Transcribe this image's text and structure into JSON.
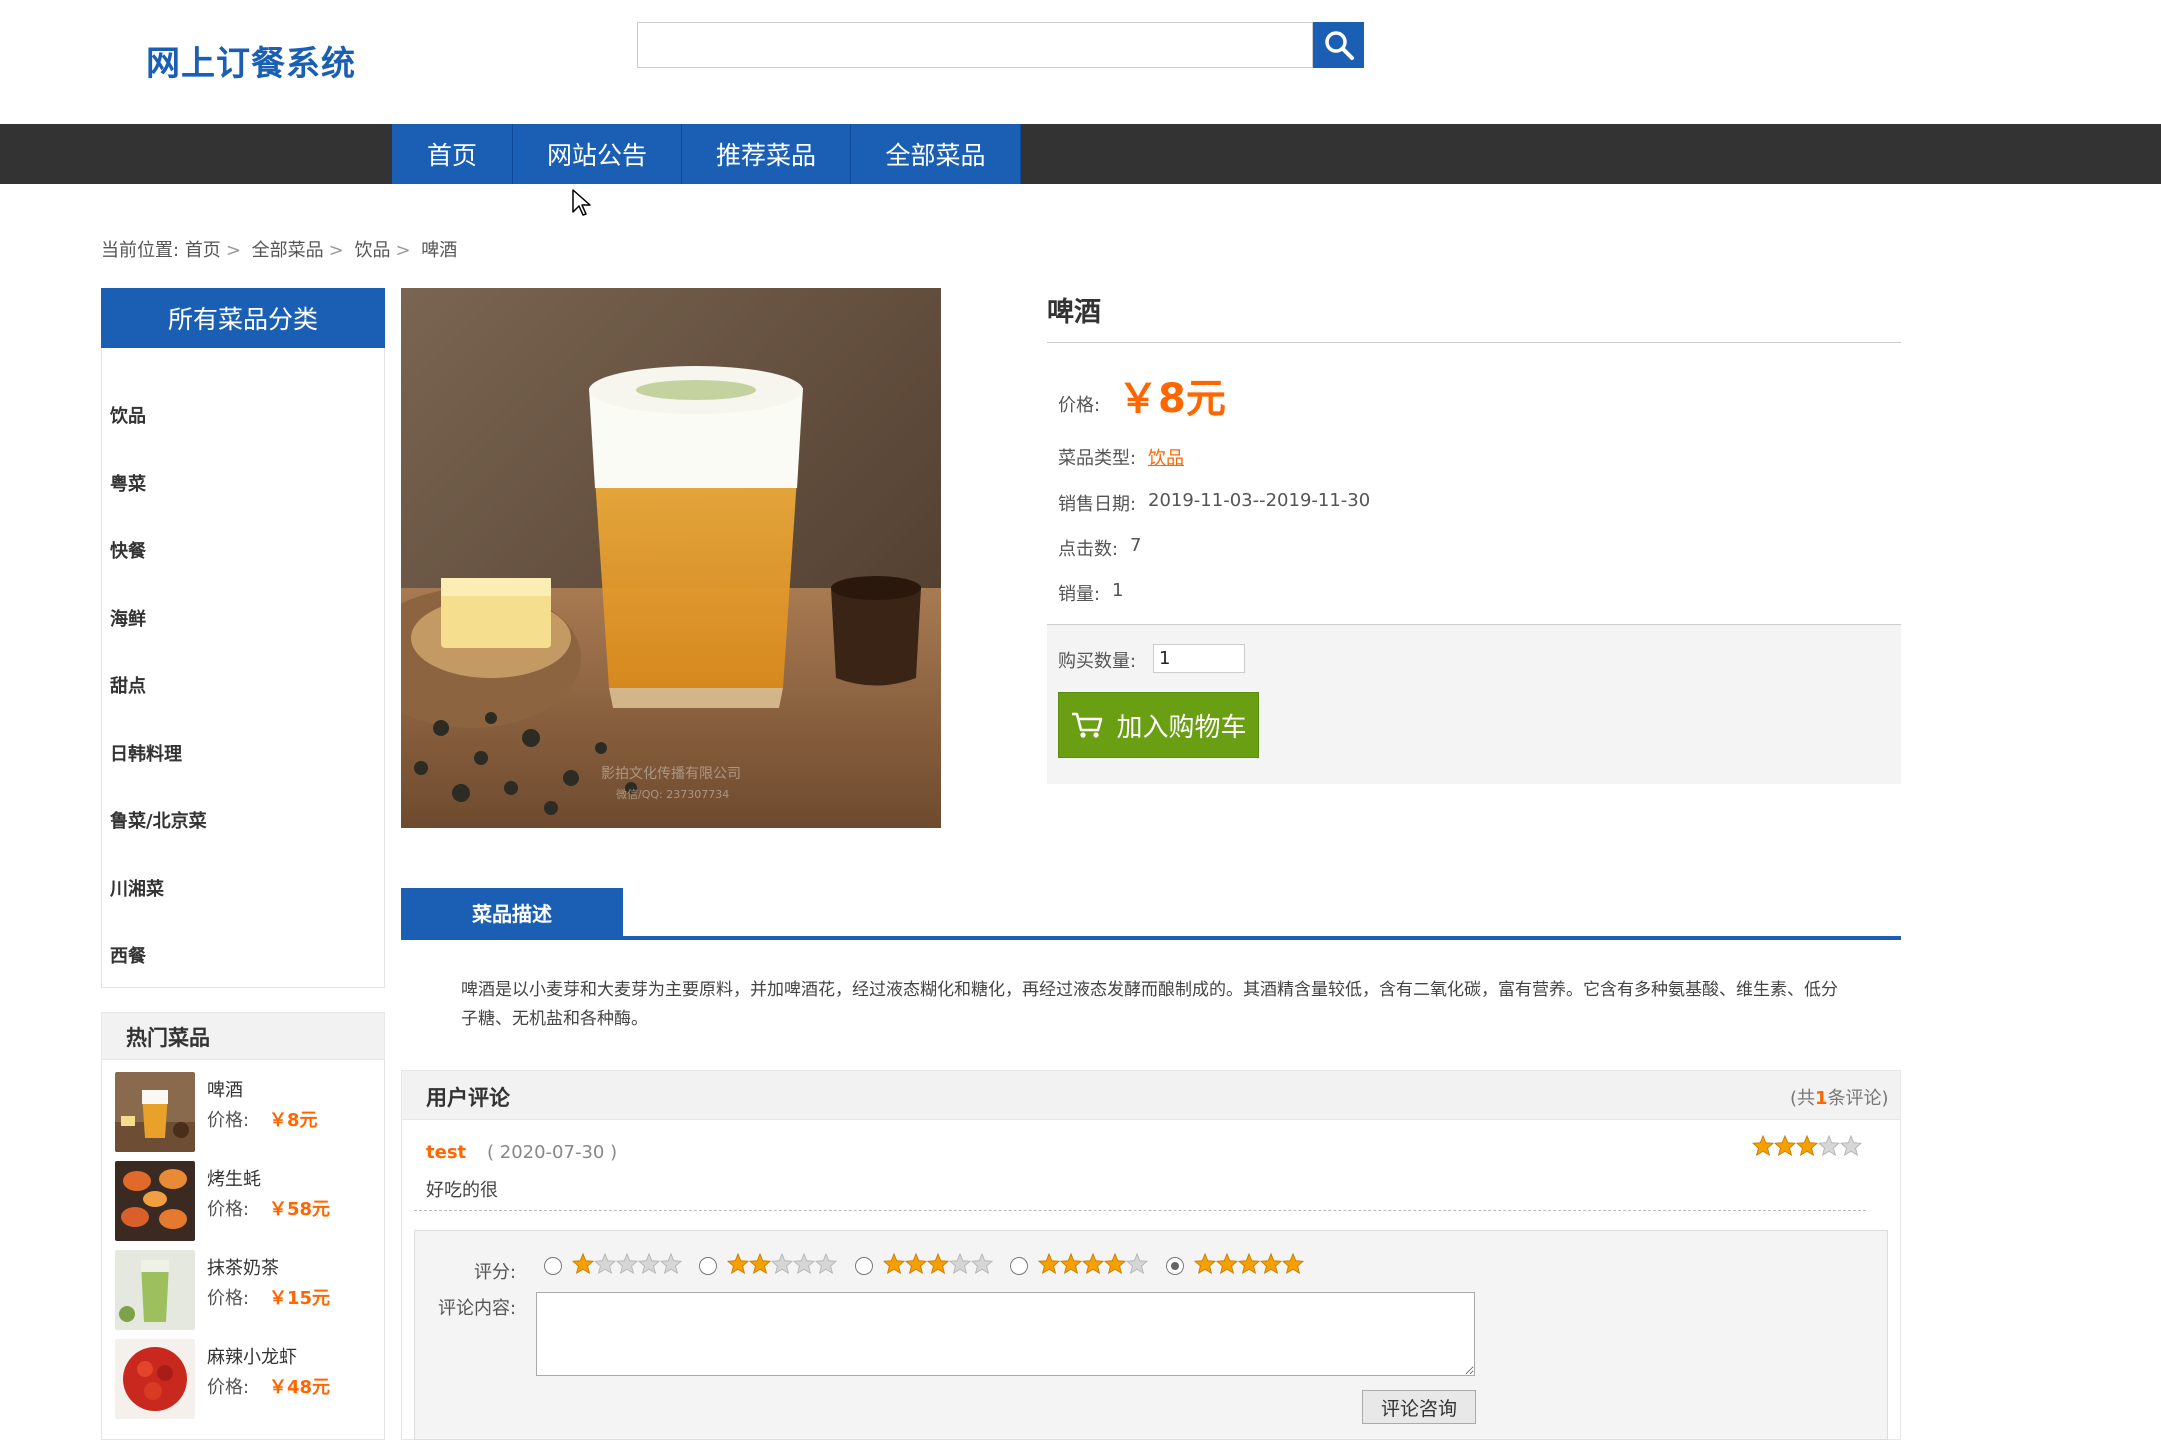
{
  "header": {
    "logo_text": "网上订餐系统",
    "search_value": ""
  },
  "nav": {
    "items": [
      "首页",
      "网站公告",
      "推荐菜品",
      "全部菜品"
    ]
  },
  "breadcrumb": {
    "prefix": "当前位置:",
    "items": [
      "首页",
      "全部菜品",
      "饮品",
      "啤酒"
    ]
  },
  "sidebar": {
    "category_title": "所有菜品分类",
    "categories": [
      "饮品",
      "粤菜",
      "快餐",
      "海鲜",
      "甜点",
      "日韩料理",
      "鲁菜/北京菜",
      "川湘菜",
      "西餐"
    ],
    "hot_title": "热门菜品",
    "hot_items": [
      {
        "name": "啤酒",
        "price_label": "价格:",
        "price": "￥8元"
      },
      {
        "name": "烤生蚝",
        "price_label": "价格:",
        "price": "￥58元"
      },
      {
        "name": "抹茶奶茶",
        "price_label": "价格:",
        "price": "￥15元"
      },
      {
        "name": "麻辣小龙虾",
        "price_label": "价格:",
        "price": "￥48元"
      }
    ]
  },
  "product": {
    "name": "啤酒",
    "price_label": "价格:",
    "price": "￥8元",
    "type_label": "菜品类型:",
    "type": "饮品",
    "date_label": "销售日期:",
    "date": "2019-11-03--2019-11-30",
    "clicks_label": "点击数:",
    "clicks": "7",
    "sales_label": "销量:",
    "sales": "1",
    "qty_label": "购买数量:",
    "qty_value": "1",
    "cart_button": "加入购物车",
    "image_watermark_1": "影拍文化传播有限公司",
    "image_watermark_2": "微信/QQ: 237307734"
  },
  "description": {
    "tab_label": "菜品描述",
    "text": "啤酒是以小麦芽和大麦芽为主要原料，并加啤酒花，经过液态糊化和糖化，再经过液态发酵而酿制成的。其酒精含量较低，含有二氧化碳，富有营养。它含有多种氨基酸、维生素、低分子糖、无机盐和各种酶。"
  },
  "reviews": {
    "title": "用户评论",
    "count_prefix": "(共",
    "count": "1",
    "count_suffix": "条评论)",
    "items": [
      {
        "user": "test",
        "date": "( 2020-07-30 )",
        "text": "好吃的很",
        "rating": 3
      }
    ],
    "form": {
      "score_label": "评分:",
      "options": [
        1,
        2,
        3,
        4,
        5
      ],
      "selected": 5,
      "content_label": "评论内容:",
      "comment_value": "",
      "submit": "评论咨询"
    }
  },
  "colors": {
    "brand_blue": "#1a5fb4",
    "accent_orange": "#ff6600",
    "cart_green": "#6a9f13",
    "nav_dark": "#333333"
  }
}
